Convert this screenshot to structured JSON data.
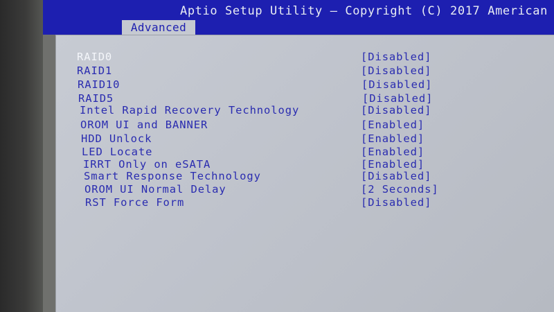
{
  "header": {
    "title": "Aptio Setup Utility – Copyright (C) 2017 American"
  },
  "tabs": [
    {
      "label": "Advanced"
    }
  ],
  "settings": [
    {
      "label": "RAID0",
      "value": "[Disabled]"
    },
    {
      "label": "RAID1",
      "value": "[Disabled]"
    },
    {
      "label": "RAID10",
      "value": "[Disabled]"
    },
    {
      "label": "RAID5",
      "value": "[Disabled]"
    },
    {
      "label": "Intel Rapid Recovery Technology",
      "value": "[Disabled]"
    },
    {
      "label": "OROM UI and BANNER",
      "value": "[Enabled]"
    },
    {
      "label": "HDD Unlock",
      "value": "[Enabled]"
    },
    {
      "label": "LED Locate",
      "value": "[Enabled]"
    },
    {
      "label": "IRRT Only on eSATA",
      "value": "[Enabled]"
    },
    {
      "label": "Smart Response Technology",
      "value": "[Disabled]"
    },
    {
      "label": "OROM UI Normal Delay",
      "value": "[2 Seconds]"
    },
    {
      "label": "RST Force Form",
      "value": "[Disabled]"
    }
  ],
  "colors": {
    "title_bar": "#1d1fb0",
    "panel_bg": "#c5c9d1",
    "item_text": "#2a2cb0",
    "selected_text": "#f4f6fa"
  }
}
